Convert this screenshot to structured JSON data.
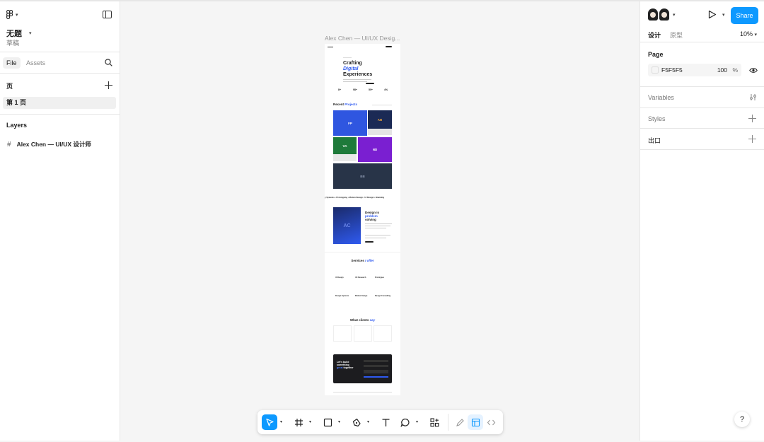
{
  "file": {
    "title": "无题",
    "subtitle": "草稿"
  },
  "left_panel": {
    "tabs": [
      {
        "label": "File"
      },
      {
        "label": "Assets"
      }
    ],
    "pages_title": "页",
    "pages": [
      {
        "label": "第 1 页"
      }
    ],
    "layers_title": "Layers",
    "layers": [
      {
        "label": "Alex Chen — UI/UX 设计师"
      }
    ]
  },
  "canvas": {
    "frame_label": "Alex Chen — UI/UX Desig...",
    "hero": {
      "line1": "Crafting",
      "line2": "Digital",
      "line3": "Experiences"
    },
    "stats": [
      "8+",
      "98+",
      "50+",
      "4%"
    ],
    "recent_projects": {
      "prefix": "Recent ",
      "accent": "Projects"
    },
    "projects": [
      {
        "label": "FP",
        "color": "#2f56e0"
      },
      {
        "label": "AB",
        "color": "#1b2a55"
      },
      {
        "label": "VA",
        "color": "#1e7a3a"
      },
      {
        "label": "ND",
        "color": "#7a1fd1"
      },
      {
        "label": "BB",
        "color": "#283448"
      }
    ],
    "marquee": "y Systems  •  Prototyping  •  Motion Design  •  UI Design  •  Branding",
    "about": {
      "badge": "AC",
      "line1": "Design is",
      "line2": "problem",
      "line3": "solving"
    },
    "services": {
      "prefix": "Services ",
      "accent": "I offer"
    },
    "service_items": [
      "UI Design",
      "UX Research",
      "Prototypes",
      "Design Systems",
      "Motion Design",
      "Design Consulting"
    ],
    "testimonials": {
      "prefix": "What clients ",
      "accent": "say"
    },
    "contact": {
      "line1": "Let's build",
      "line2": "something",
      "accent": "great",
      "line3": " together"
    }
  },
  "right_panel": {
    "share_label": "Share",
    "modes": [
      {
        "label": "设计"
      },
      {
        "label": "原型"
      }
    ],
    "zoom": "10%",
    "page": {
      "title": "Page",
      "color_hex": "F5F5F5",
      "opacity": "100",
      "opacity_unit": "%"
    },
    "sections": [
      {
        "label": "Variables"
      },
      {
        "label": "Styles"
      },
      {
        "label": "出口"
      }
    ],
    "help_label": "?"
  },
  "colors": {
    "accent": "#0d99ff",
    "canvas_bg": "#f5f5f5",
    "brand_blue": "#2f5af0"
  }
}
